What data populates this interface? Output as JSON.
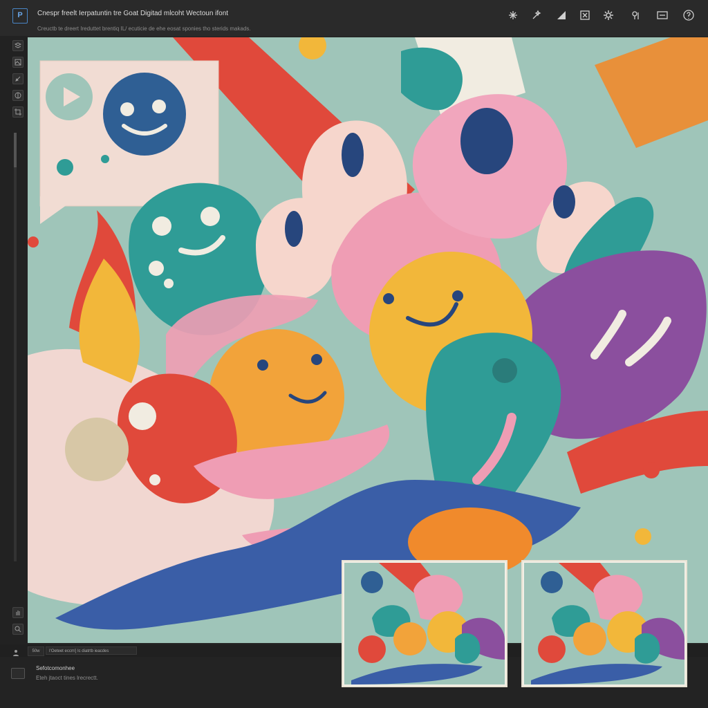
{
  "app": {
    "logo_text": "P",
    "title": "Cnespr freelt Ierpatuntin tre Goat Digitad mlcoht Wectoun ifont",
    "subtitle": "Creuctb te dreert Ireduttet brentiq IL/ ecuticie de ehe eosat sponies tho sterids makads."
  },
  "toolbar": {
    "icons": [
      "sparkle-icon",
      "magic-wand-icon",
      "ruler-icon",
      "transform-icon",
      "settings-icon",
      "info-icon",
      "preview-icon",
      "help-icon"
    ]
  },
  "status": {
    "zoom": "50w",
    "info": "I'Oeteet eccm'j Ic diatrtb ieacdes"
  },
  "bottom_panel": {
    "title": "Sefotcomonhee",
    "description": "Eteh jtaoct tines lrecrectt."
  },
  "colors": {
    "teal": "#2f9c96",
    "yellow": "#f2b73a",
    "orange": "#f08a2c",
    "pink": "#ef9db4",
    "red": "#e0493b",
    "purple": "#8b4f9e",
    "blue": "#3a5ea7",
    "navy": "#27467d",
    "mint": "#9fc5b9"
  }
}
